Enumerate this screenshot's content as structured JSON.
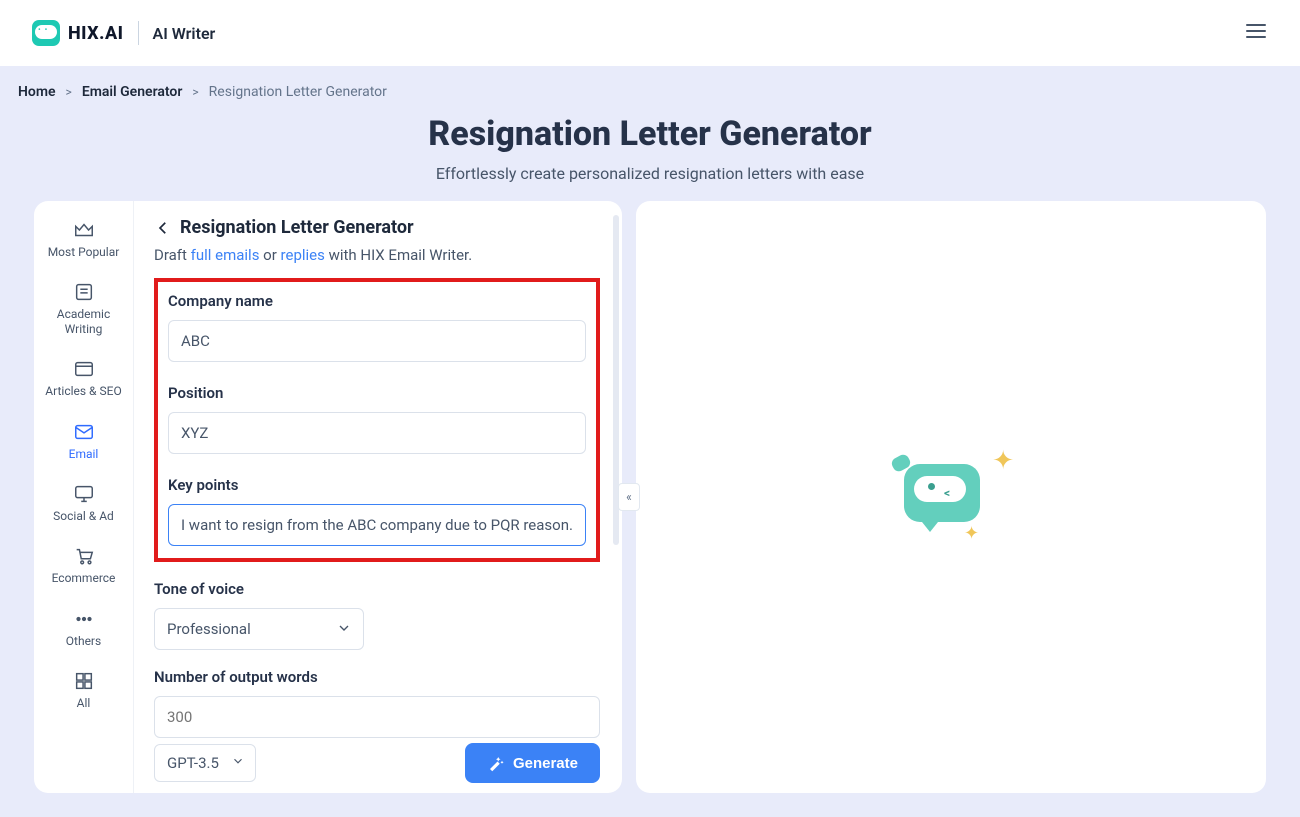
{
  "brand": {
    "name": "HIX.AI",
    "sub": "AI Writer"
  },
  "menu_icon": "menu-icon",
  "breadcrumb": {
    "home": "Home",
    "email_gen": "Email Generator",
    "current": "Resignation Letter Generator"
  },
  "hero": {
    "title": "Resignation Letter Generator",
    "subtitle": "Effortlessly create personalized resignation letters with ease"
  },
  "sidebar": {
    "items": [
      {
        "label": "Most Popular",
        "icon": "crown-icon"
      },
      {
        "label": "Academic Writing",
        "icon": "document-icon"
      },
      {
        "label": "Articles & SEO",
        "icon": "browser-icon"
      },
      {
        "label": "Email",
        "icon": "mail-icon",
        "active": true
      },
      {
        "label": "Social & Ad",
        "icon": "monitor-icon"
      },
      {
        "label": "Ecommerce",
        "icon": "cart-icon"
      },
      {
        "label": "Others",
        "icon": "dots-icon"
      },
      {
        "label": "All",
        "icon": "grid-icon"
      }
    ]
  },
  "form": {
    "back_icon": "chevron-left-icon",
    "title": "Resignation Letter Generator",
    "sub_pre": "Draft ",
    "sub_link1": "full emails",
    "sub_mid": " or ",
    "sub_link2": "replies",
    "sub_post": " with HIX Email Writer.",
    "company_label": "Company name",
    "company_value": "ABC",
    "position_label": "Position",
    "position_value": "XYZ",
    "keypoints_label": "Key points",
    "keypoints_value": "I want to resign from the ABC company due to PQR reason...",
    "tone_label": "Tone of voice",
    "tone_value": "Professional",
    "words_label": "Number of output words",
    "words_placeholder": "300",
    "model_value": "GPT-3.5",
    "generate_label": "Generate"
  },
  "collapse_glyph": "«"
}
